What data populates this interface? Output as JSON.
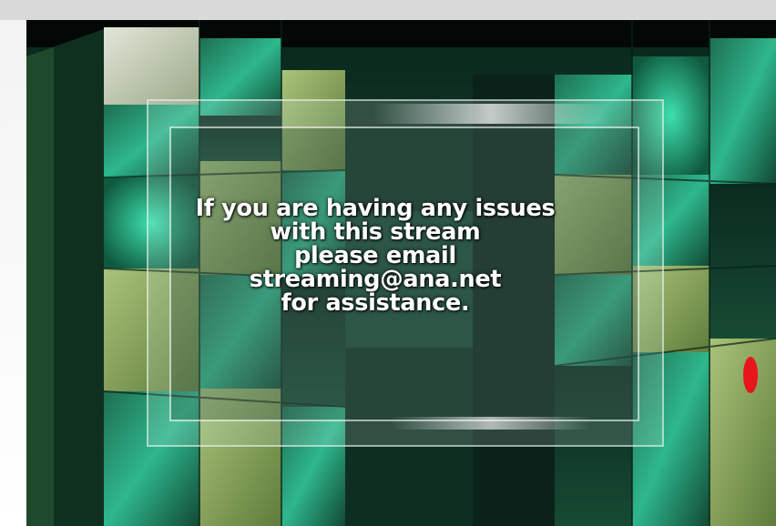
{
  "message_lines": [
    "If you are having any issues",
    "with this stream",
    "please email",
    "streaming@ana.net",
    "for assistance."
  ],
  "colors": {
    "frame_bg": "#d9d9d9",
    "video_bg": "#020604",
    "accent_green": "#2fb78c",
    "indicator": "#e8161b"
  }
}
